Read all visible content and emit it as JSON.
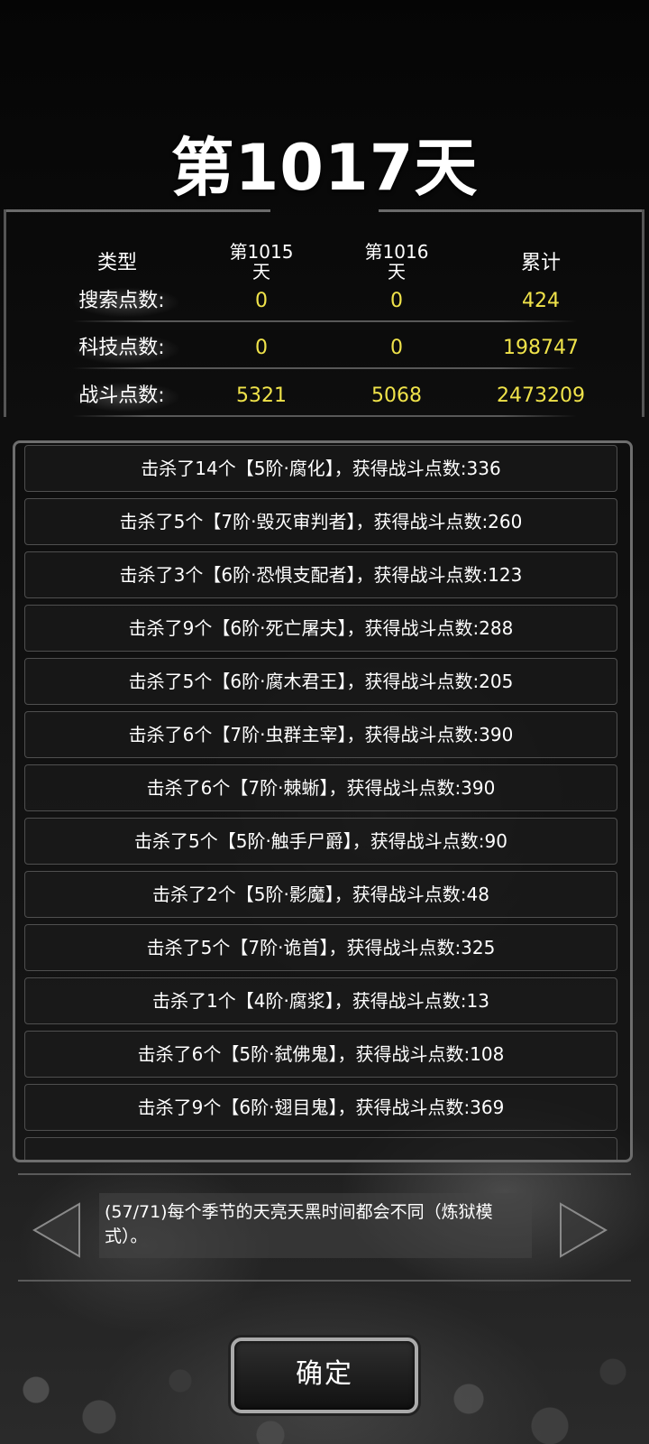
{
  "title": "第1017天",
  "stats": {
    "headers": [
      "类型",
      "第1015\n天",
      "第1016\n天",
      "累计"
    ],
    "rows": [
      {
        "label": "搜索点数:",
        "v1": "0",
        "v2": "0",
        "total": "424"
      },
      {
        "label": "科技点数:",
        "v1": "0",
        "v2": "0",
        "total": "198747"
      },
      {
        "label": "战斗点数:",
        "v1": "5321",
        "v2": "5068",
        "total": "2473209"
      }
    ]
  },
  "log": [
    "击杀了14个【5阶·腐化】，获得战斗点数:336",
    "击杀了5个【7阶·毁灭审判者】，获得战斗点数:260",
    "击杀了3个【6阶·恐惧支配者】，获得战斗点数:123",
    "击杀了9个【6阶·死亡屠夫】，获得战斗点数:288",
    "击杀了5个【6阶·腐木君王】，获得战斗点数:205",
    "击杀了6个【7阶·虫群主宰】，获得战斗点数:390",
    "击杀了6个【7阶·棘蜥】，获得战斗点数:390",
    "击杀了5个【5阶·触手尸爵】，获得战斗点数:90",
    "击杀了2个【5阶·影魔】，获得战斗点数:48",
    "击杀了5个【7阶·诡首】，获得战斗点数:325",
    "击杀了1个【4阶·腐浆】，获得战斗点数:13",
    "击杀了6个【5阶·弑佛鬼】，获得战斗点数:108",
    "击杀了9个【6阶·翅目鬼】，获得战斗点数:369"
  ],
  "tip": {
    "line1": "(57/71)每个季节的天亮天黑时间都会不同（炼狱模",
    "line2": "式）。"
  },
  "confirm_label": "确定",
  "colors": {
    "value": "#f0e34a",
    "text": "#ffffff",
    "border": "#6e6e6e"
  },
  "icons": {
    "prev": "left-triangle-arrow",
    "next": "right-triangle-arrow"
  }
}
